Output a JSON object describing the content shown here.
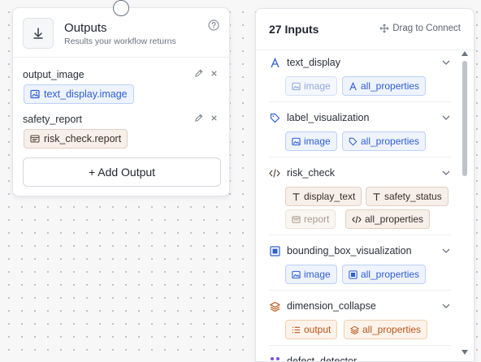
{
  "outputs": {
    "title": "Outputs",
    "subtitle": "Results your workflow returns",
    "rows": [
      {
        "label": "output_image",
        "chip": "text_display.image"
      },
      {
        "label": "safety_report",
        "chip": "risk_check.report"
      }
    ],
    "add_button": "+ Add Output"
  },
  "inputs": {
    "title": "27 Inputs",
    "drag_hint": "Drag to Connect",
    "items": [
      {
        "name": "text_display",
        "chips": [
          "image",
          "all_properties"
        ]
      },
      {
        "name": "label_visualization",
        "chips": [
          "image",
          "all_properties"
        ]
      },
      {
        "name": "risk_check",
        "chips": [
          "display_text",
          "safety_status",
          "report",
          "all_properties"
        ]
      },
      {
        "name": "bounding_box_visualization",
        "chips": [
          "image",
          "all_properties"
        ]
      },
      {
        "name": "dimension_collapse",
        "chips": [
          "output",
          "all_properties"
        ]
      },
      {
        "name": "defect_detector",
        "chips": []
      }
    ]
  },
  "colors": {
    "accent_blue": "#2f5fd0",
    "accent_orange": "#b4561a",
    "canvas_bg": "#f7f7f8"
  }
}
